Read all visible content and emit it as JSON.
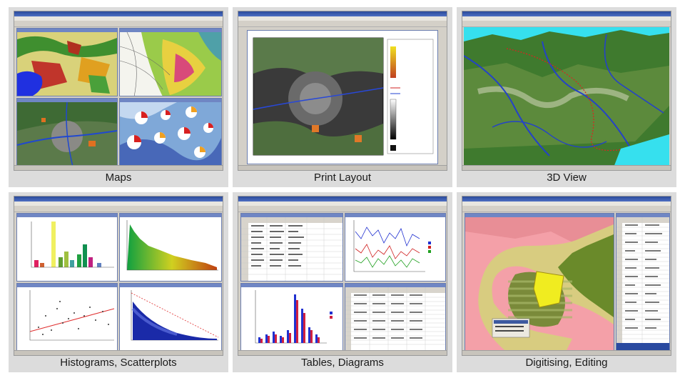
{
  "tiles": [
    {
      "id": "maps",
      "caption": "Maps"
    },
    {
      "id": "print-layout",
      "caption": "Print Layout"
    },
    {
      "id": "3d-view",
      "caption": "3D View"
    },
    {
      "id": "histograms",
      "caption": "Histograms, Scatterplots"
    },
    {
      "id": "tables",
      "caption": "Tables, Diagrams"
    },
    {
      "id": "digitising",
      "caption": "Digitising, Editing"
    }
  ],
  "colors": {
    "tile_bg": "#dcdcdc",
    "window_title": "#4d6fc3",
    "desktop": "#d4d0c8",
    "terrain_green": "#3d7a2a",
    "river_blue": "#2040c0",
    "sky": "#33e0f0"
  }
}
